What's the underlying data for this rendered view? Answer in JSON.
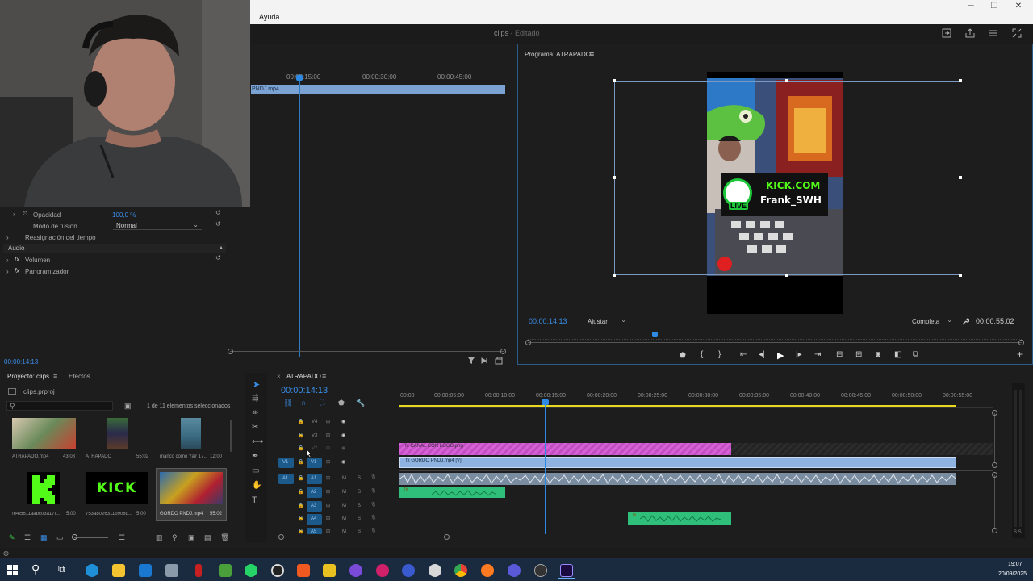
{
  "menu": {
    "help": "Ayuda"
  },
  "window": {
    "title": "clips",
    "status": "Editado"
  },
  "source": {
    "ruler": [
      "00:00:15:00",
      "00:00:30:00",
      "00:00:45:00"
    ],
    "clip_name": "PNDJ.mp4",
    "timecode": "00:00:14:13"
  },
  "effects": {
    "opacity_label": "Opacidad",
    "opacity_value": "100,0 %",
    "blend_label": "Modo de fusión",
    "blend_value": "Normal",
    "time_remap": "Reasignación del tiempo",
    "audio_header": "Audio",
    "volume": "Volumen",
    "panner": "Panoramizador"
  },
  "program": {
    "title": "Programa: ATRAPADO",
    "timecode": "00:00:14:13",
    "fit": "Ajustar",
    "quality": "Completa",
    "duration": "00:00:55:02",
    "overlay_site": "KICK.COM",
    "overlay_user": "Frank_SWH",
    "overlay_live": "LIVE"
  },
  "project": {
    "tab_project": "Proyecto: clips",
    "tab_effects": "Efectos",
    "file": "clips.prproj",
    "selection": "1 de 11 elementos seleccionados",
    "items": [
      {
        "name": "ATRAPADO.mp4",
        "duration": "43:08"
      },
      {
        "name": "ATRAPADO",
        "duration": "55:02"
      },
      {
        "name": "manco como Yair 17...",
        "duration": "12:00"
      },
      {
        "name": "f64f5611aabc03a17f...",
        "duration": "5:00"
      },
      {
        "name": "753a8026311b908d...",
        "duration": "5:00"
      },
      {
        "name": "GORDO PNDJ.mp4",
        "duration": "55:02"
      }
    ],
    "kick_text": "KICK"
  },
  "timeline": {
    "sequence": "ATRAPADO",
    "timecode": "00:00:14:13",
    "ruler": [
      "00:00",
      "00:00:05:00",
      "00:00:10:00",
      "00:00:15:00",
      "00:00:20:00",
      "00:00:25:00",
      "00:00:30:00",
      "00:00:35:00",
      "00:00:40:00",
      "00:00:45:00",
      "00:00:50:00",
      "00:00:55:00"
    ],
    "video_tracks": [
      "V4",
      "V3",
      "V2",
      "V1"
    ],
    "audio_tracks": [
      "A1",
      "A2",
      "A3",
      "A4",
      "A5"
    ],
    "source_v": "V1",
    "source_a": "A1",
    "track_m": "M",
    "track_s": "S",
    "clip_logo": "CANAL CON LOGO.png",
    "clip_video": "GORDO PNDJ.mp4 [V]",
    "meter_label": "S S"
  },
  "taskbar": {
    "time": "19:07",
    "date": "20/09/2025"
  },
  "colors": {
    "accent": "#2d8ceb",
    "video_clip": "#8fb3e0",
    "logo_clip": "#d05ad0",
    "audio_clip": "#2fbf7a"
  }
}
